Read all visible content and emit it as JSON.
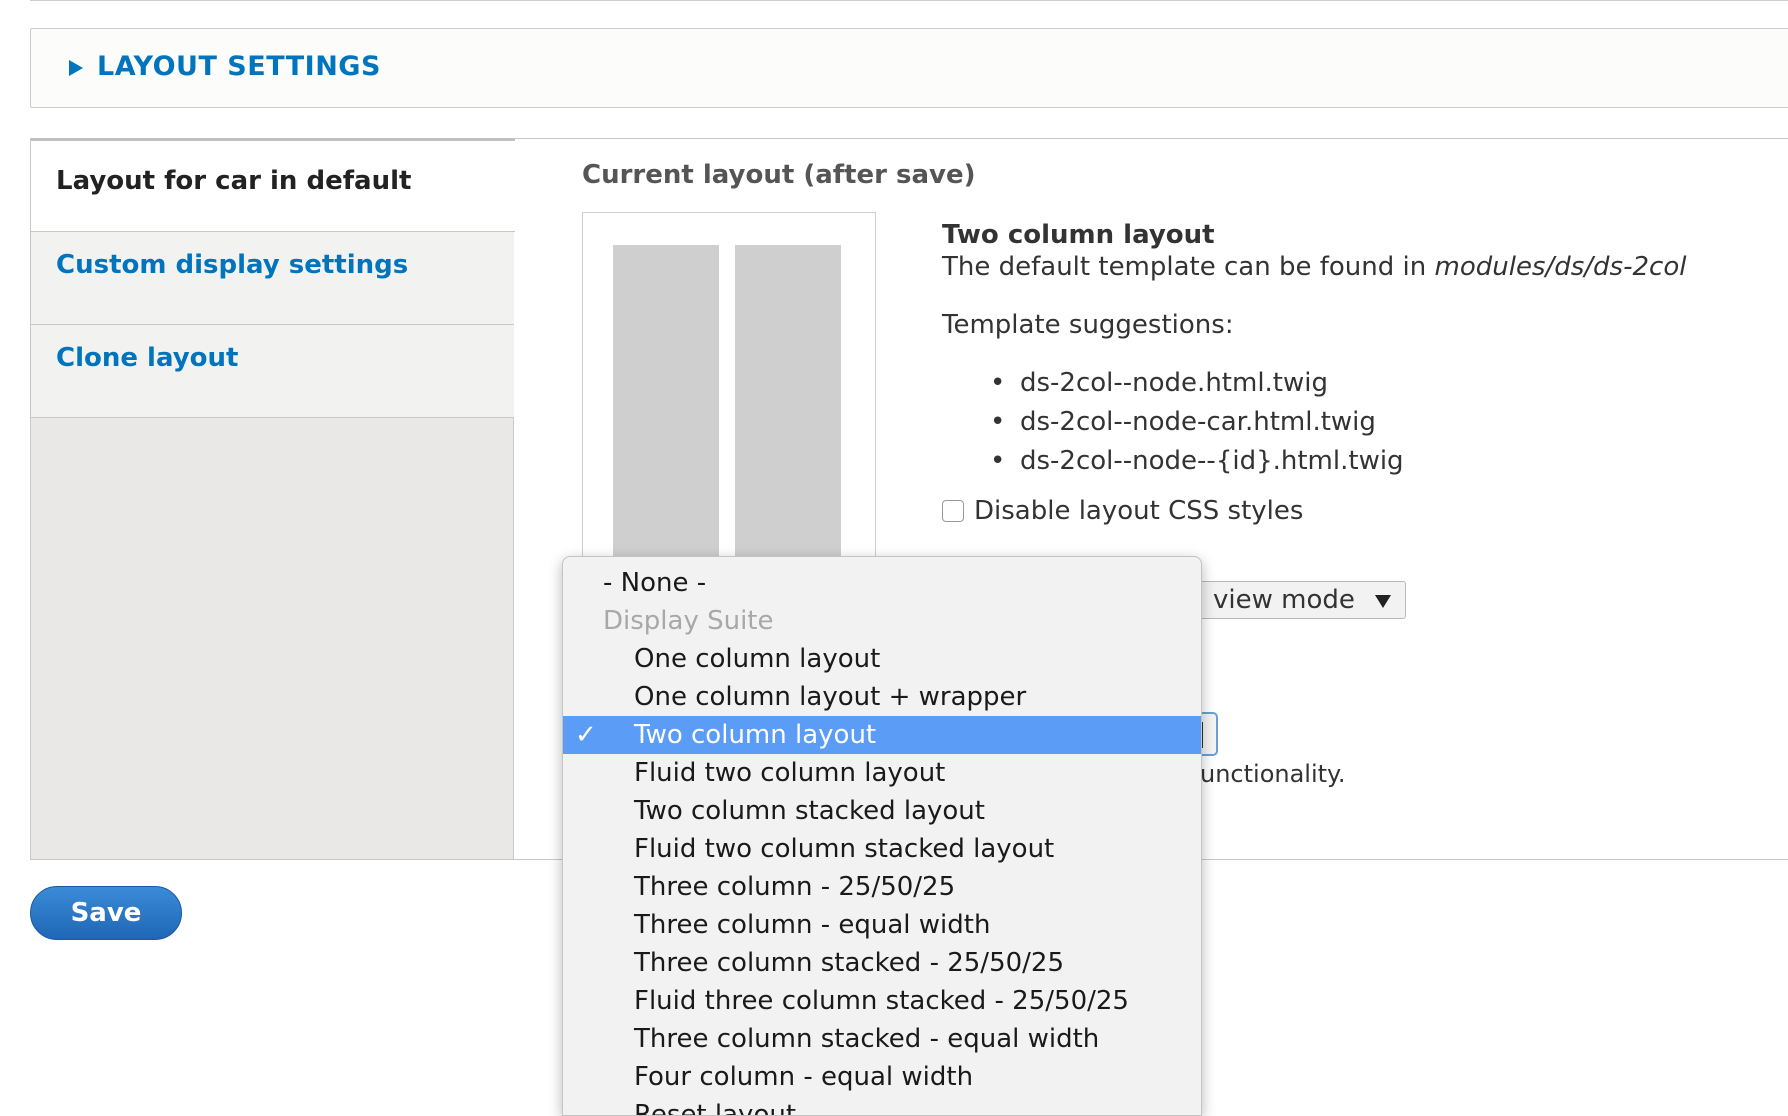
{
  "details": {
    "summary": "LAYOUT SETTINGS"
  },
  "vertical_tabs": {
    "items": [
      {
        "label": "Layout for car in default"
      },
      {
        "label": "Custom display settings"
      },
      {
        "label": "Clone layout"
      }
    ]
  },
  "pane": {
    "title": "Current layout (after save)",
    "layout_name": "Two column layout",
    "desc_prefix": "The default template can be found in ",
    "desc_path": "modules/ds/ds-2col",
    "suggestions_label": "Template suggestions:",
    "suggestions": [
      "ds-2col--node.html.twig",
      "ds-2col--node-car.html.twig",
      "ds-2col--node--{id}.html.twig"
    ],
    "disable_css_label": "Disable layout CSS styles",
    "view_mode_partial": "view mode",
    "help_tail": "unctionality."
  },
  "save_label": "Save",
  "dropdown": {
    "options": [
      {
        "label": "- None -",
        "type": "option"
      },
      {
        "label": "Display Suite",
        "type": "group"
      },
      {
        "label": "One column layout",
        "type": "option"
      },
      {
        "label": "One column layout + wrapper",
        "type": "option"
      },
      {
        "label": "Two column layout",
        "type": "option",
        "selected": true
      },
      {
        "label": "Fluid two column layout",
        "type": "option"
      },
      {
        "label": "Two column stacked layout",
        "type": "option"
      },
      {
        "label": "Fluid two column stacked layout",
        "type": "option"
      },
      {
        "label": "Three column - 25/50/25",
        "type": "option"
      },
      {
        "label": "Three column - equal width",
        "type": "option"
      },
      {
        "label": "Three column stacked - 25/50/25",
        "type": "option"
      },
      {
        "label": "Fluid three column stacked - 25/50/25",
        "type": "option"
      },
      {
        "label": "Three column stacked - equal width",
        "type": "option"
      },
      {
        "label": "Four column - equal width",
        "type": "option"
      },
      {
        "label": "Reset layout",
        "type": "option"
      }
    ],
    "check_glyph": "✓"
  },
  "colors": {
    "link": "#0074bd",
    "selected": "#5b9cf6",
    "save": "#1f66b6"
  }
}
